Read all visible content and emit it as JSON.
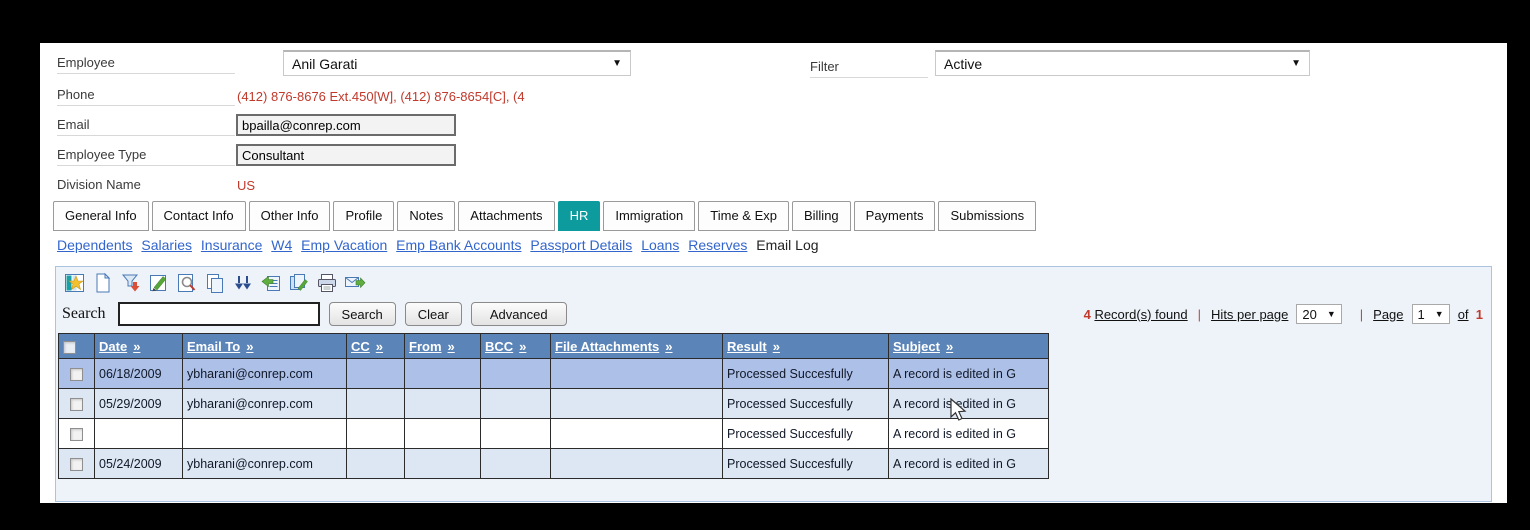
{
  "form": {
    "employee_label": "Employee",
    "employee_value": "Anil Garati",
    "phone_label": "Phone",
    "phone_value": "(412) 876-8676 Ext.450[W], (412) 876-8654[C], (4",
    "email_label": "Email",
    "email_value": "bpailla@conrep.com",
    "employee_type_label": "Employee Type",
    "employee_type_value": "Consultant",
    "division_label": "Division Name",
    "division_value": "US",
    "filter_label": "Filter",
    "filter_value": "Active",
    "dropdown_arrow": "▼"
  },
  "tabs": [
    "General Info",
    "Contact Info",
    "Other Info",
    "Profile",
    "Notes",
    "Attachments",
    "HR",
    "Immigration",
    "Time & Exp",
    "Billing",
    "Payments",
    "Submissions"
  ],
  "active_tab": "HR",
  "subnav": {
    "links": [
      "Dependents",
      "Salaries",
      "Insurance",
      "W4",
      "Emp Vacation",
      "Emp Bank Accounts",
      "Passport Details",
      "Loans",
      "Reserves"
    ],
    "current": "Email Log"
  },
  "toolbar": {
    "icons": [
      "customize",
      "new-record",
      "filter-export",
      "edit",
      "preview",
      "copy",
      "apply-all",
      "revert-list",
      "copy-edit",
      "print",
      "send-email"
    ]
  },
  "search": {
    "label": "Search",
    "input_value": "",
    "search_button": "Search",
    "clear_button": "Clear",
    "advanced_button": "Advanced"
  },
  "pagination": {
    "count": "4",
    "records_label": "Record(s) found",
    "separator": "|",
    "hits_label": "Hits per page",
    "hits_value": "20",
    "page_label": "Page",
    "page_value": "1",
    "of_label": "of",
    "total_pages": "1",
    "dropdown_arrow": "▼"
  },
  "table": {
    "sort_indicator": "»",
    "headers": [
      "Date",
      "Email To",
      "CC",
      "From",
      "BCC",
      "File Attachments",
      "Result",
      "Subject"
    ],
    "rows": [
      {
        "date": "06/18/2009",
        "email_to": "ybharani@conrep.com",
        "cc": "",
        "from": "",
        "bcc": "",
        "file_attachments": "",
        "result": "Processed Succesfully",
        "subject": "A record is edited in G"
      },
      {
        "date": "05/29/2009",
        "email_to": "ybharani@conrep.com",
        "cc": "",
        "from": "",
        "bcc": "",
        "file_attachments": "",
        "result": "Processed Succesfully",
        "subject": "A record is edited in G"
      },
      {
        "date": "",
        "email_to": "",
        "cc": "",
        "from": "",
        "bcc": "",
        "file_attachments": "",
        "result": "Processed Succesfully",
        "subject": "A record is edited in G"
      },
      {
        "date": "05/24/2009",
        "email_to": "ybharani@conrep.com",
        "cc": "",
        "from": "",
        "bcc": "",
        "file_attachments": "",
        "result": "Processed Succesfully",
        "subject": "A record is edited in G"
      }
    ]
  },
  "colors": {
    "active_tab_teal": "#0d9b9e",
    "table_header_blue": "#5b85b8",
    "selected_row": "#adc0e8",
    "alt_row": "#dde7f3",
    "link_blue": "#3366cc",
    "alert_red": "#c0392b",
    "panel_bg": "#eef3fa",
    "panel_border": "#aac4de"
  }
}
